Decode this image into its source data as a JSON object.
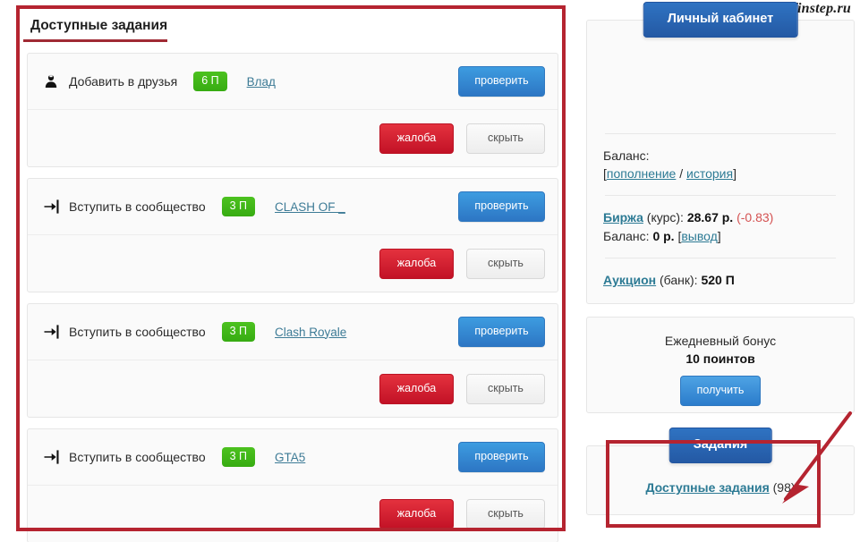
{
  "watermark": "1st-finstep.ru",
  "left": {
    "section_title": "Доступные задания",
    "buttons": {
      "check": "проверить",
      "report": "жалоба",
      "hide": "скрыть"
    },
    "tasks": [
      {
        "icon": "person-add-icon",
        "label": "Добавить в друзья",
        "points": "6 П",
        "target": "Влад"
      },
      {
        "icon": "sign-in-icon",
        "label": "Вступить в сообщество",
        "points": "3 П",
        "target": "CLASH OF _"
      },
      {
        "icon": "sign-in-icon",
        "label": "Вступить в сообщество",
        "points": "3 П",
        "target": "Clash Royale"
      },
      {
        "icon": "sign-in-icon",
        "label": "Вступить в сообщество",
        "points": "3 П",
        "target": "GTA5"
      }
    ]
  },
  "right": {
    "account": {
      "tab_label": "Личный кабинет",
      "balance_label": "Баланс:",
      "bracket_open": "[",
      "topup_link": "пополнение",
      "separator": " / ",
      "history_link": "история",
      "bracket_close": "]",
      "exchange_link": "Биржа",
      "exchange_rate_label": " (курс): ",
      "exchange_rate_value": "28.67 р.",
      "exchange_delta": "(-0.83)",
      "exchange_balance_label": "Баланс: ",
      "exchange_balance_value": "0 р.",
      "withdraw_open": "[",
      "withdraw_link": "вывод",
      "withdraw_close": "]",
      "auction_link": "Аукцион",
      "auction_bank_label": " (банк): ",
      "auction_bank_value": "520 П"
    },
    "bonus": {
      "title": "Ежедневный бонус",
      "amount": "10 поинтов",
      "claim_button": "получить"
    },
    "tasks": {
      "tab_label": "Задания",
      "available_link": "Доступные задания",
      "available_count": "(98)"
    }
  },
  "annotation": {
    "color": "#b52430"
  }
}
